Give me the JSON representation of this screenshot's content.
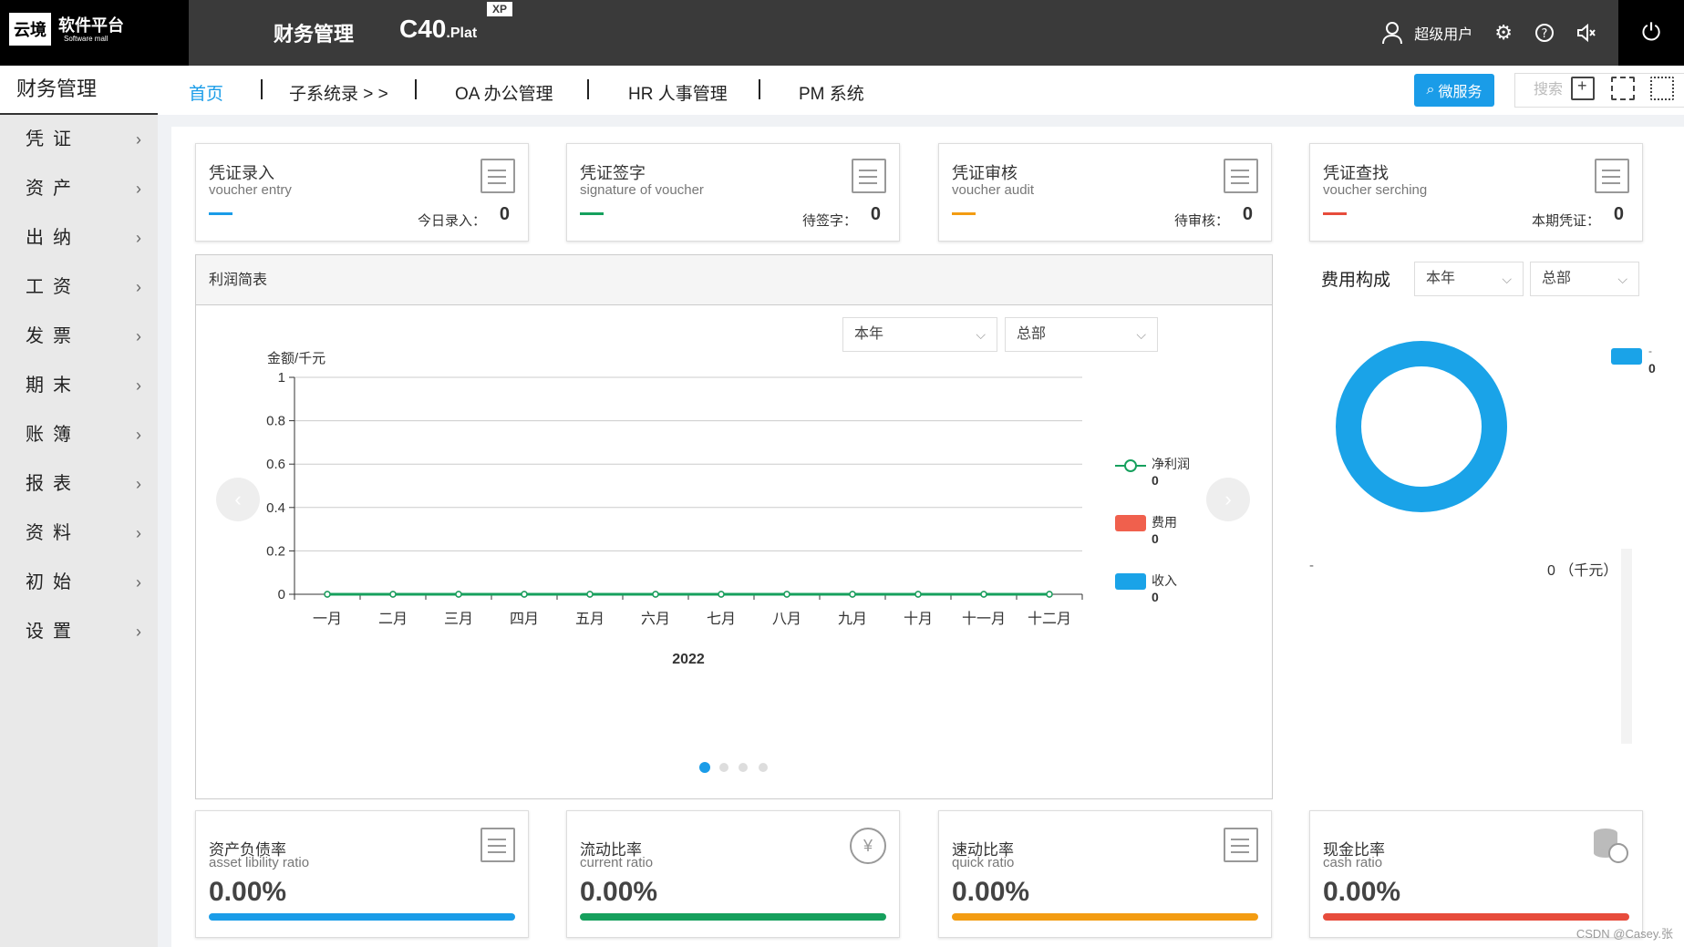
{
  "topbar": {
    "logo_box": "云境",
    "logo_text": "软件平台",
    "logo_sub": "Software mall",
    "title": "财务管理",
    "brand": "C40",
    "brand_suffix": ".Plat",
    "brand_badge": "XP",
    "user_name": "超级用户"
  },
  "sidebar": {
    "header": "财务管理",
    "items": [
      {
        "label": "凭证"
      },
      {
        "label": "资产"
      },
      {
        "label": "出纳"
      },
      {
        "label": "工资"
      },
      {
        "label": "发票"
      },
      {
        "label": "期末"
      },
      {
        "label": "账簿"
      },
      {
        "label": "报表"
      },
      {
        "label": "资料"
      },
      {
        "label": "初始"
      },
      {
        "label": "设置"
      }
    ]
  },
  "tabs": [
    {
      "label": "首页"
    },
    {
      "label": "子系统录 > >"
    },
    {
      "label": "OA 办公管理"
    },
    {
      "label": "HR 人事管理"
    },
    {
      "label": "PM 系统"
    }
  ],
  "toolbar": {
    "micro_label": "微服务",
    "search_placeholder": "搜索"
  },
  "voucher_cards": [
    {
      "title": "凭证录入",
      "subtitle": "voucher entry",
      "count_label": "今日录入：",
      "count": "0",
      "accent": "#1a9ce8"
    },
    {
      "title": "凭证签字",
      "subtitle": "signature of voucher",
      "count_label": "待签字：",
      "count": "0",
      "accent": "#16a05d"
    },
    {
      "title": "凭证审核",
      "subtitle": "voucher audit",
      "count_label": "待审核：",
      "count": "0",
      "accent": "#f39c12"
    },
    {
      "title": "凭证查找",
      "subtitle": "voucher serching",
      "count_label": "本期凭证：",
      "count": "0",
      "accent": "#e74c3c"
    }
  ],
  "profit_panel": {
    "title": "利润简表",
    "period_select": "本年",
    "scope_select": "总部"
  },
  "chart_data": {
    "type": "line",
    "ylabel": "金额/千元",
    "xlabel": "2022",
    "categories": [
      "一月",
      "二月",
      "三月",
      "四月",
      "五月",
      "六月",
      "七月",
      "八月",
      "九月",
      "十月",
      "十一月",
      "十二月"
    ],
    "ylim": [
      0,
      1
    ],
    "yticks": [
      "0",
      "0.2",
      "0.4",
      "0.6",
      "0.8",
      "1"
    ],
    "series": [
      {
        "name": "净利润",
        "values": [
          0,
          0,
          0,
          0,
          0,
          0,
          0,
          0,
          0,
          0,
          0,
          0
        ],
        "total": "0",
        "color": "#16a05d"
      },
      {
        "name": "费用",
        "values": [
          0,
          0,
          0,
          0,
          0,
          0,
          0,
          0,
          0,
          0,
          0,
          0
        ],
        "total": "0",
        "color": "#f0604d"
      },
      {
        "name": "收入",
        "values": [
          0,
          0,
          0,
          0,
          0,
          0,
          0,
          0,
          0,
          0,
          0,
          0
        ],
        "total": "0",
        "color": "#1aa3e8"
      }
    ],
    "legend": "right",
    "grid": true
  },
  "expense": {
    "title": "费用构成",
    "period_select": "本年",
    "scope_select": "总部",
    "legend_label": "-",
    "legend_value": "0",
    "list_label": "-",
    "list_value": "0 （千元）",
    "donut_color": "#1aa3e8"
  },
  "ratio_cards": [
    {
      "title": "资产负债率",
      "subtitle": "asset libility ratio",
      "value": "0.00%",
      "color": "#1a9ce8"
    },
    {
      "title": "流动比率",
      "subtitle": "current ratio",
      "value": "0.00%",
      "color": "#16a05d"
    },
    {
      "title": "速动比率",
      "subtitle": "quick ratio",
      "value": "0.00%",
      "color": "#f39c12"
    },
    {
      "title": "现金比率",
      "subtitle": "cash ratio",
      "value": "0.00%",
      "color": "#e74c3c"
    }
  ],
  "watermark": "CSDN @Casey.张"
}
